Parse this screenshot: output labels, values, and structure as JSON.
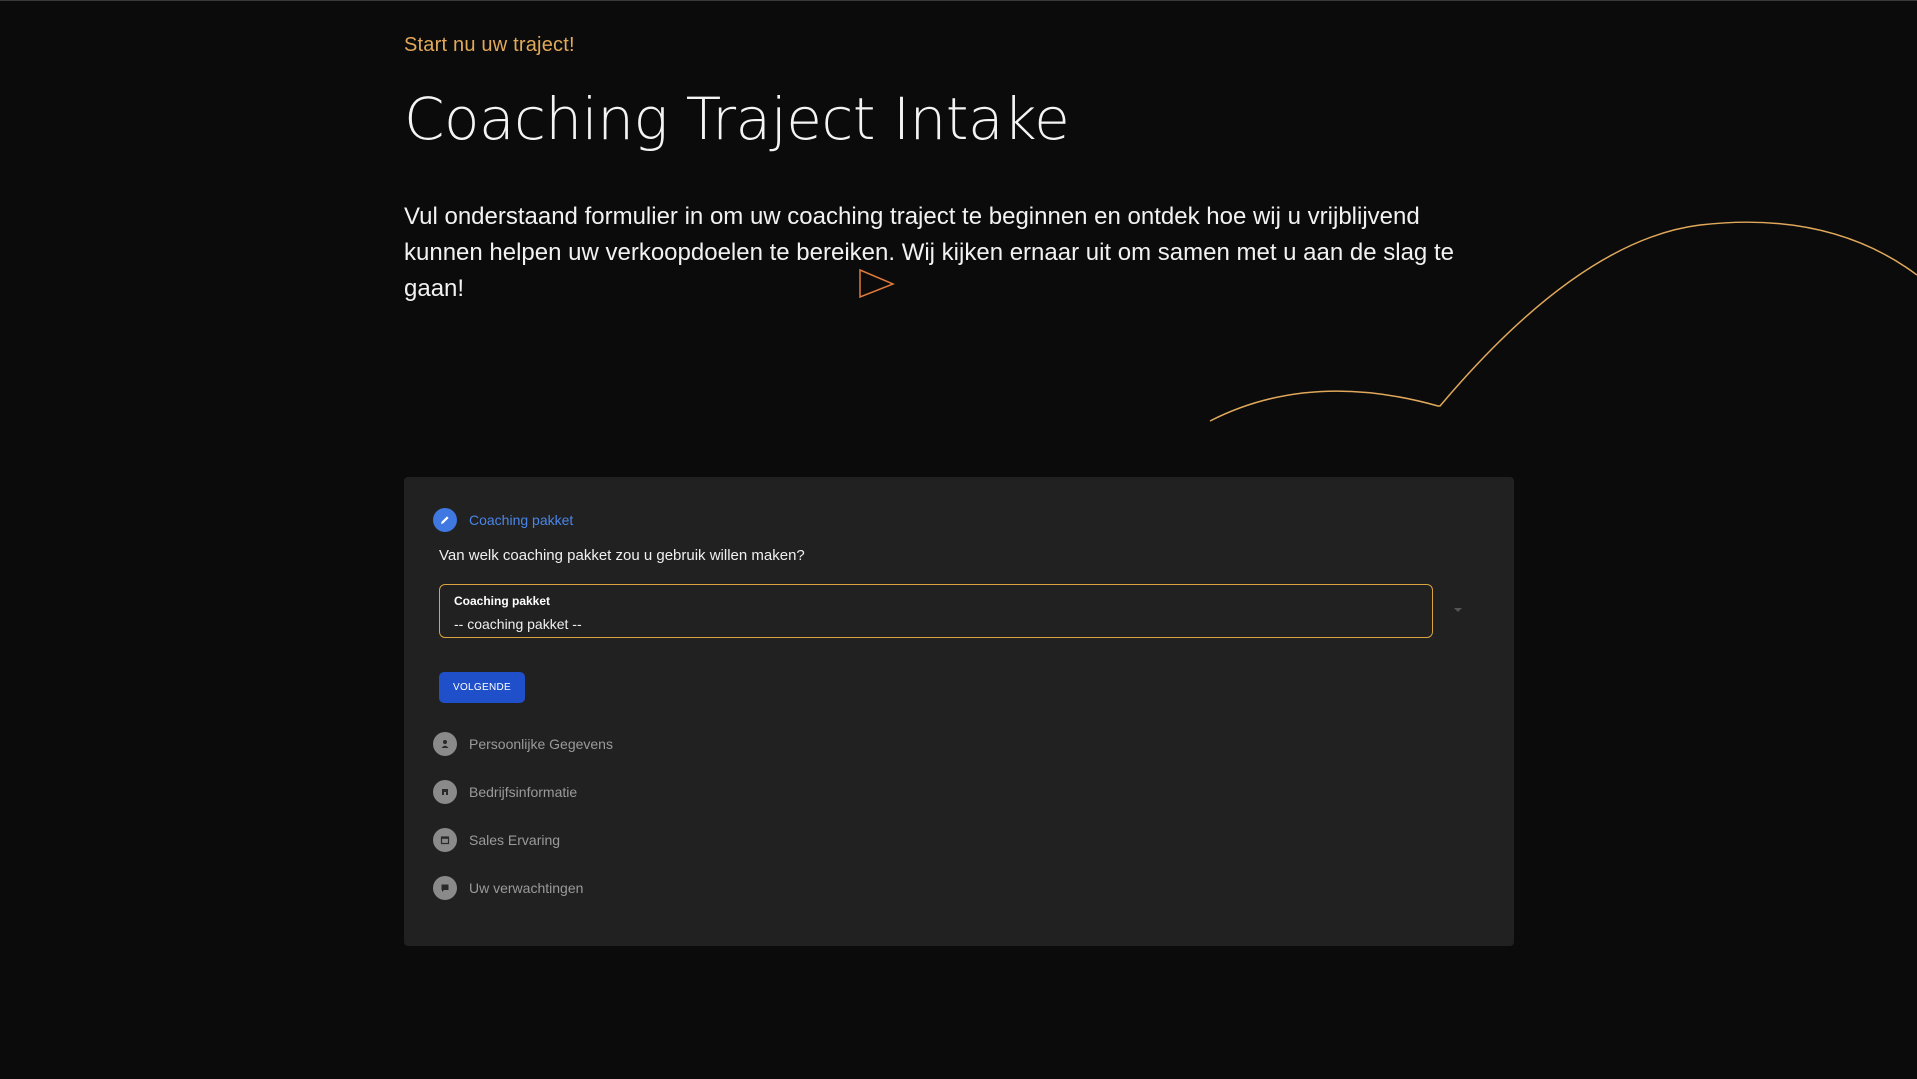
{
  "hero": {
    "eyebrow": "Start nu uw traject!",
    "title": "Coaching Traject Intake",
    "intro": "Vul onderstaand formulier in om uw coaching traject te beginnen en ontdek hoe wij u vrijblijvend kunnen helpen uw verkoopdoelen te bereiken. Wij kijken ernaar uit om samen met u aan de slag te gaan!"
  },
  "colors": {
    "accent": "#e0a85a",
    "active_step": "#4a86e8",
    "button": "#1f4fc9",
    "card": "#212121",
    "background": "#0b0b0c"
  },
  "form": {
    "active_step": {
      "label": "Coaching pakket",
      "icon": "pencil-icon"
    },
    "question": "Van welk coaching pakket zou u gebruik willen maken?",
    "select": {
      "label": "Coaching pakket",
      "value": "-- coaching pakket --"
    },
    "next_button": "VOLGENDE",
    "steps": [
      {
        "label": "Persoonlijke Gegevens",
        "icon": "person-icon"
      },
      {
        "label": "Bedrijfsinformatie",
        "icon": "building-icon"
      },
      {
        "label": "Sales Ervaring",
        "icon": "calendar-icon"
      },
      {
        "label": "Uw verwachtingen",
        "icon": "comment-icon"
      }
    ]
  }
}
